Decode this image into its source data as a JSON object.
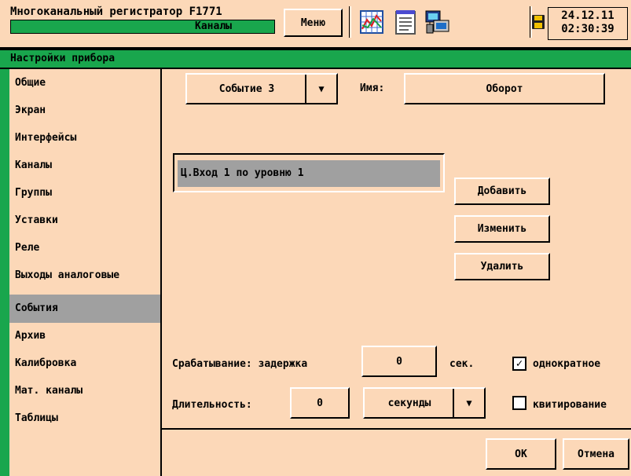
{
  "header": {
    "app_title": "Многоканальный регистратор F1771",
    "current_page": "Каналы",
    "menu_label": "Меню",
    "date": "24.12.11",
    "time": "02:30:39",
    "icons": [
      "chart-icon",
      "notepad-icon",
      "network-computer-icon",
      "floppy-disk-icon"
    ]
  },
  "section_title": "Настройки прибора",
  "sidebar": {
    "items": [
      {
        "label": "Общие"
      },
      {
        "label": "Экран"
      },
      {
        "label": "Интерфейсы"
      },
      {
        "label": "Каналы"
      },
      {
        "label": "Группы"
      },
      {
        "label": "Уставки"
      },
      {
        "label": "Реле"
      },
      {
        "label": "Выходы аналоговые"
      },
      {
        "label": "События",
        "selected": true
      },
      {
        "label": "Архив"
      },
      {
        "label": "Калибровка"
      },
      {
        "label": "Мат. каналы"
      },
      {
        "label": "Таблицы"
      }
    ]
  },
  "event": {
    "selector_value": "Событие 3",
    "name_label": "Имя:",
    "name_value": "Оборот",
    "conditions": [
      "Ц.Вход 1 по уровню 1"
    ],
    "add_label": "Добавить",
    "edit_label": "Изменить",
    "delete_label": "Удалить",
    "trigger_label": "Срабатывание: задержка",
    "trigger_delay": "0",
    "trigger_unit": "сек.",
    "oneshot_label": "однократное",
    "oneshot_checked": true,
    "duration_label": "Длительность:",
    "duration_value": "0",
    "duration_unit": "секунды",
    "ack_label": "квитирование",
    "ack_checked": false
  },
  "footer": {
    "ok_label": "OK",
    "cancel_label": "Отмена"
  },
  "colors": {
    "background": "#fcd8b8",
    "accent_green": "#19a64d",
    "selection_gray": "#a0a0a0"
  }
}
